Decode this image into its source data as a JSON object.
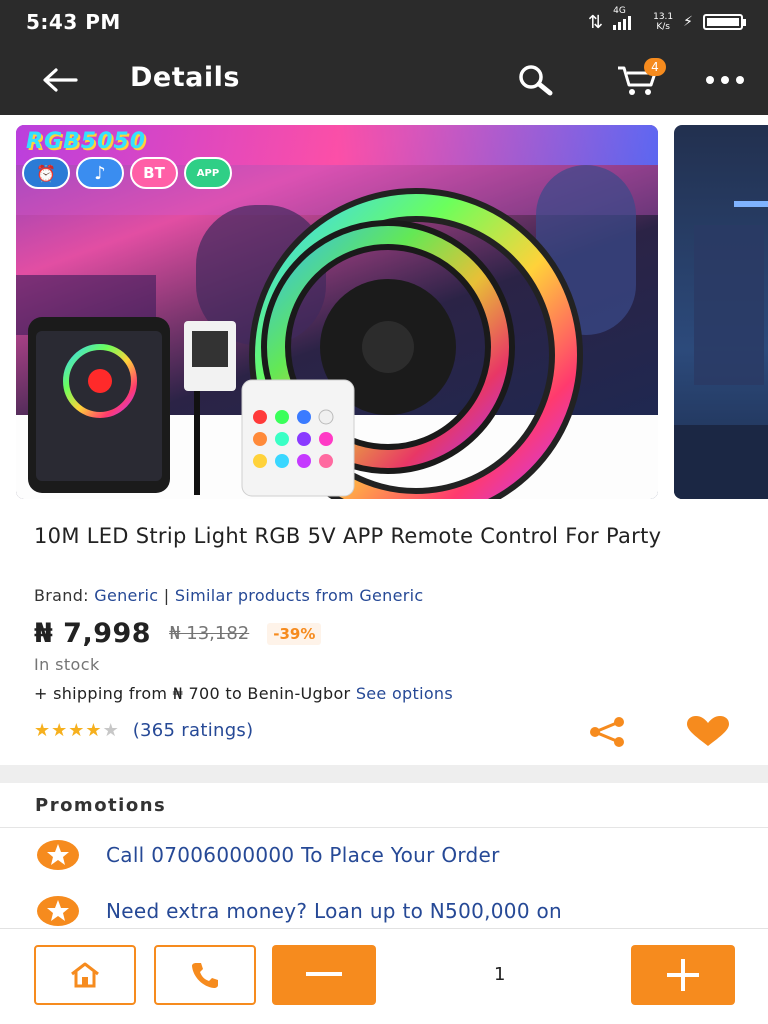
{
  "status_bar": {
    "time": "5:43 PM",
    "network": "4G",
    "speed_value": "13.1",
    "speed_unit": "K/s"
  },
  "app_bar": {
    "title": "Details",
    "cart_count": "4"
  },
  "gallery": {
    "banner_text": "RGB5050",
    "feature_badges": [
      "⏰",
      "♪",
      "BT",
      "APP"
    ]
  },
  "product": {
    "title": "10M LED Strip Light RGB 5V APP Remote Control For Party",
    "brand_label": "Brand:",
    "brand_name": "Generic",
    "brand_separator": "|",
    "similar_link": "Similar products from Generic",
    "price": "₦ 7,998",
    "old_price": "₦ 13,182",
    "discount": "-39%",
    "stock": "In stock",
    "shipping_text": "+ shipping from ₦ 700 to Benin-Ugbor",
    "shipping_link": "See options",
    "rating_value": 4,
    "rating_max": 5,
    "ratings_count": "(365 ratings)"
  },
  "promotions": {
    "heading": "Promotions",
    "items": [
      {
        "text": "Call 07006000000 To Place Your Order"
      },
      {
        "text": "Need extra money? Loan up to N500,000 on"
      }
    ]
  },
  "bottom_bar": {
    "quantity": "1"
  },
  "colors": {
    "accent": "#f68b1e",
    "link": "#264996",
    "appbar": "#2b2b2b"
  }
}
